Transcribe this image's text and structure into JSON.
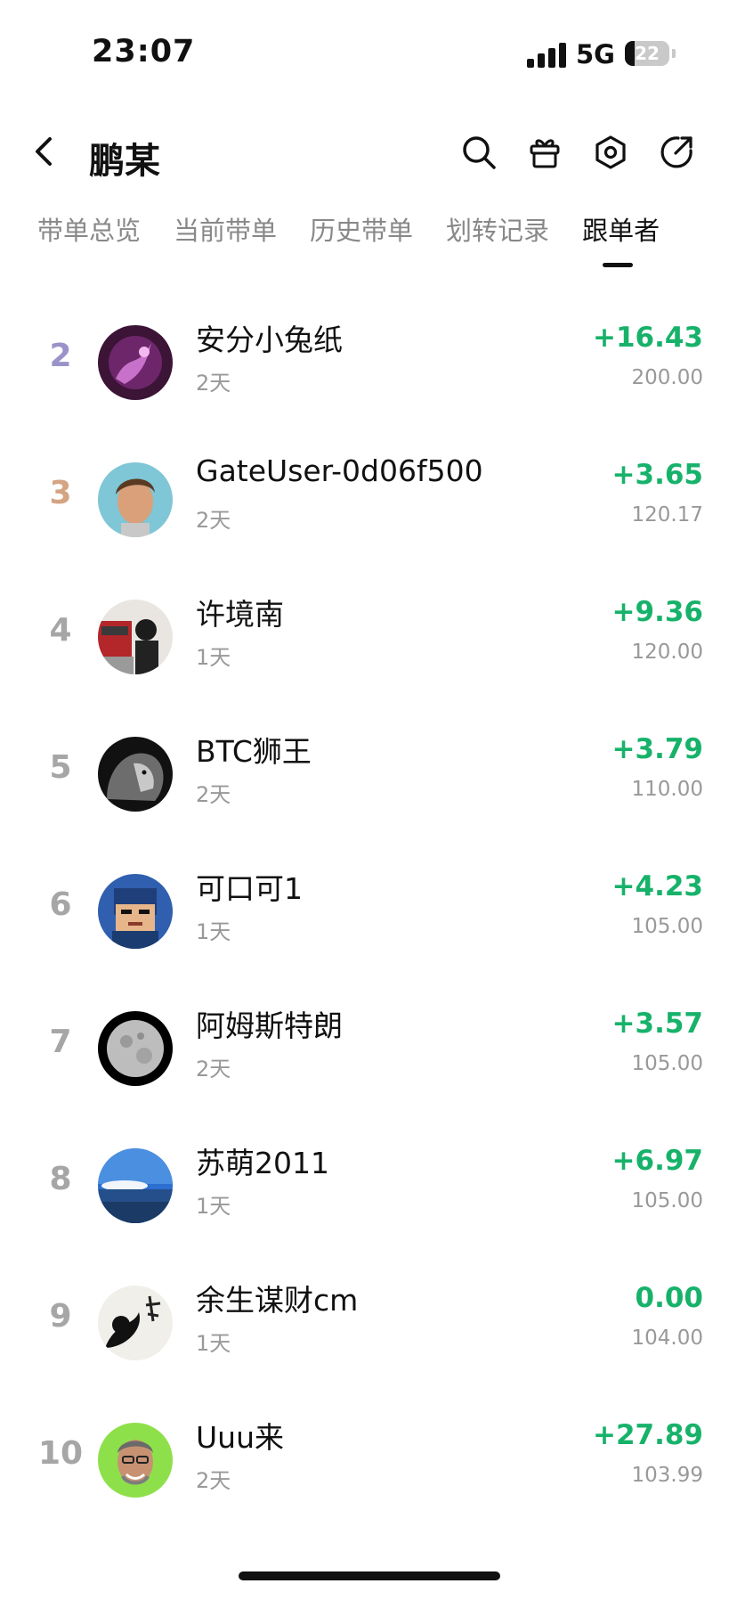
{
  "status_bar": {
    "time": "23:07",
    "network": "5G",
    "battery": "22",
    "battery_level": 0.22
  },
  "header": {
    "title": "鹏某",
    "icons": [
      "back-arrow-icon",
      "search-icon",
      "gift-icon",
      "settings-hexagon-icon",
      "share-icon"
    ]
  },
  "tabs": [
    {
      "label": "带单总览",
      "active": false
    },
    {
      "label": "当前带单",
      "active": false
    },
    {
      "label": "历史带单",
      "active": false
    },
    {
      "label": "划转记录",
      "active": false
    },
    {
      "label": "跟单者",
      "active": true
    }
  ],
  "followers": [
    {
      "rank": "2",
      "rank_color": "#9a93c9",
      "name": "安分小兔纸",
      "days": "2天",
      "pnl": "+16.43",
      "amount": "200.00",
      "avatar": "purple-nebula"
    },
    {
      "rank": "3",
      "rank_color": "#d4a483",
      "name": "GateUser-0d06f500",
      "days": "2天",
      "pnl": "+3.65",
      "amount": "120.17",
      "avatar": "man-portrait"
    },
    {
      "rank": "4",
      "rank_color": "#a6a6a6",
      "name": "许境南",
      "days": "1天",
      "pnl": "+9.36",
      "amount": "120.00",
      "avatar": "street-girl"
    },
    {
      "rank": "5",
      "rank_color": "#a6a6a6",
      "name": "BTC狮王",
      "days": "2天",
      "pnl": "+3.79",
      "amount": "110.00",
      "avatar": "lion"
    },
    {
      "rank": "6",
      "rank_color": "#a6a6a6",
      "name": "可口可1",
      "days": "1天",
      "pnl": "+4.23",
      "amount": "105.00",
      "avatar": "cartoon-blue"
    },
    {
      "rank": "7",
      "rank_color": "#a6a6a6",
      "name": "阿姆斯特朗",
      "days": "2天",
      "pnl": "+3.57",
      "amount": "105.00",
      "avatar": "moon"
    },
    {
      "rank": "8",
      "rank_color": "#a6a6a6",
      "name": "苏萌2011",
      "days": "1天",
      "pnl": "+6.97",
      "amount": "105.00",
      "avatar": "sky-sea"
    },
    {
      "rank": "9",
      "rank_color": "#a6a6a6",
      "name": "余生谋财cm",
      "days": "1天",
      "pnl": "0.00",
      "amount": "104.00",
      "avatar": "ink-art"
    },
    {
      "rank": "10",
      "rank_color": "#a6a6a6",
      "name": "Uuu来",
      "days": "2天",
      "pnl": "+27.89",
      "amount": "103.99",
      "avatar": "smiling-man"
    }
  ],
  "colors": {
    "positive": "#17b26a",
    "muted": "#999999",
    "text": "#111111"
  }
}
